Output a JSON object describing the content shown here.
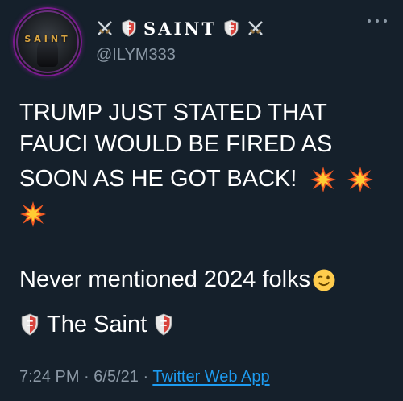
{
  "tweet": {
    "author": {
      "display_name": "SAINT",
      "handle": "@ILYM333",
      "avatar_text": "SAINT",
      "name_prefix_icons": [
        "crossed-swords-icon",
        "shield-icon"
      ],
      "name_suffix_icons": [
        "shield-icon",
        "crossed-swords-icon"
      ]
    },
    "text_lines": [
      "TRUMP JUST STATED THAT",
      "FAUCI WOULD BE FIRED AS",
      "SOON AS HE GOT BACK!"
    ],
    "line3_emojis": [
      "collision-icon",
      "collision-icon"
    ],
    "line4_emojis": [
      "collision-icon"
    ],
    "paragraph2": "Never mentioned 2024 folks",
    "paragraph2_emoji": "winking-face-icon",
    "signature": "The Saint",
    "signature_icons": [
      "shield-icon",
      "shield-icon"
    ],
    "meta": {
      "time": "7:24 PM",
      "separator": "·",
      "date": "6/5/21",
      "separator2": "·",
      "source": "Twitter Web App"
    },
    "colors": {
      "background": "#15202b",
      "text": "#ffffff",
      "muted": "#8b98a5",
      "link": "#1d9bf0"
    }
  }
}
